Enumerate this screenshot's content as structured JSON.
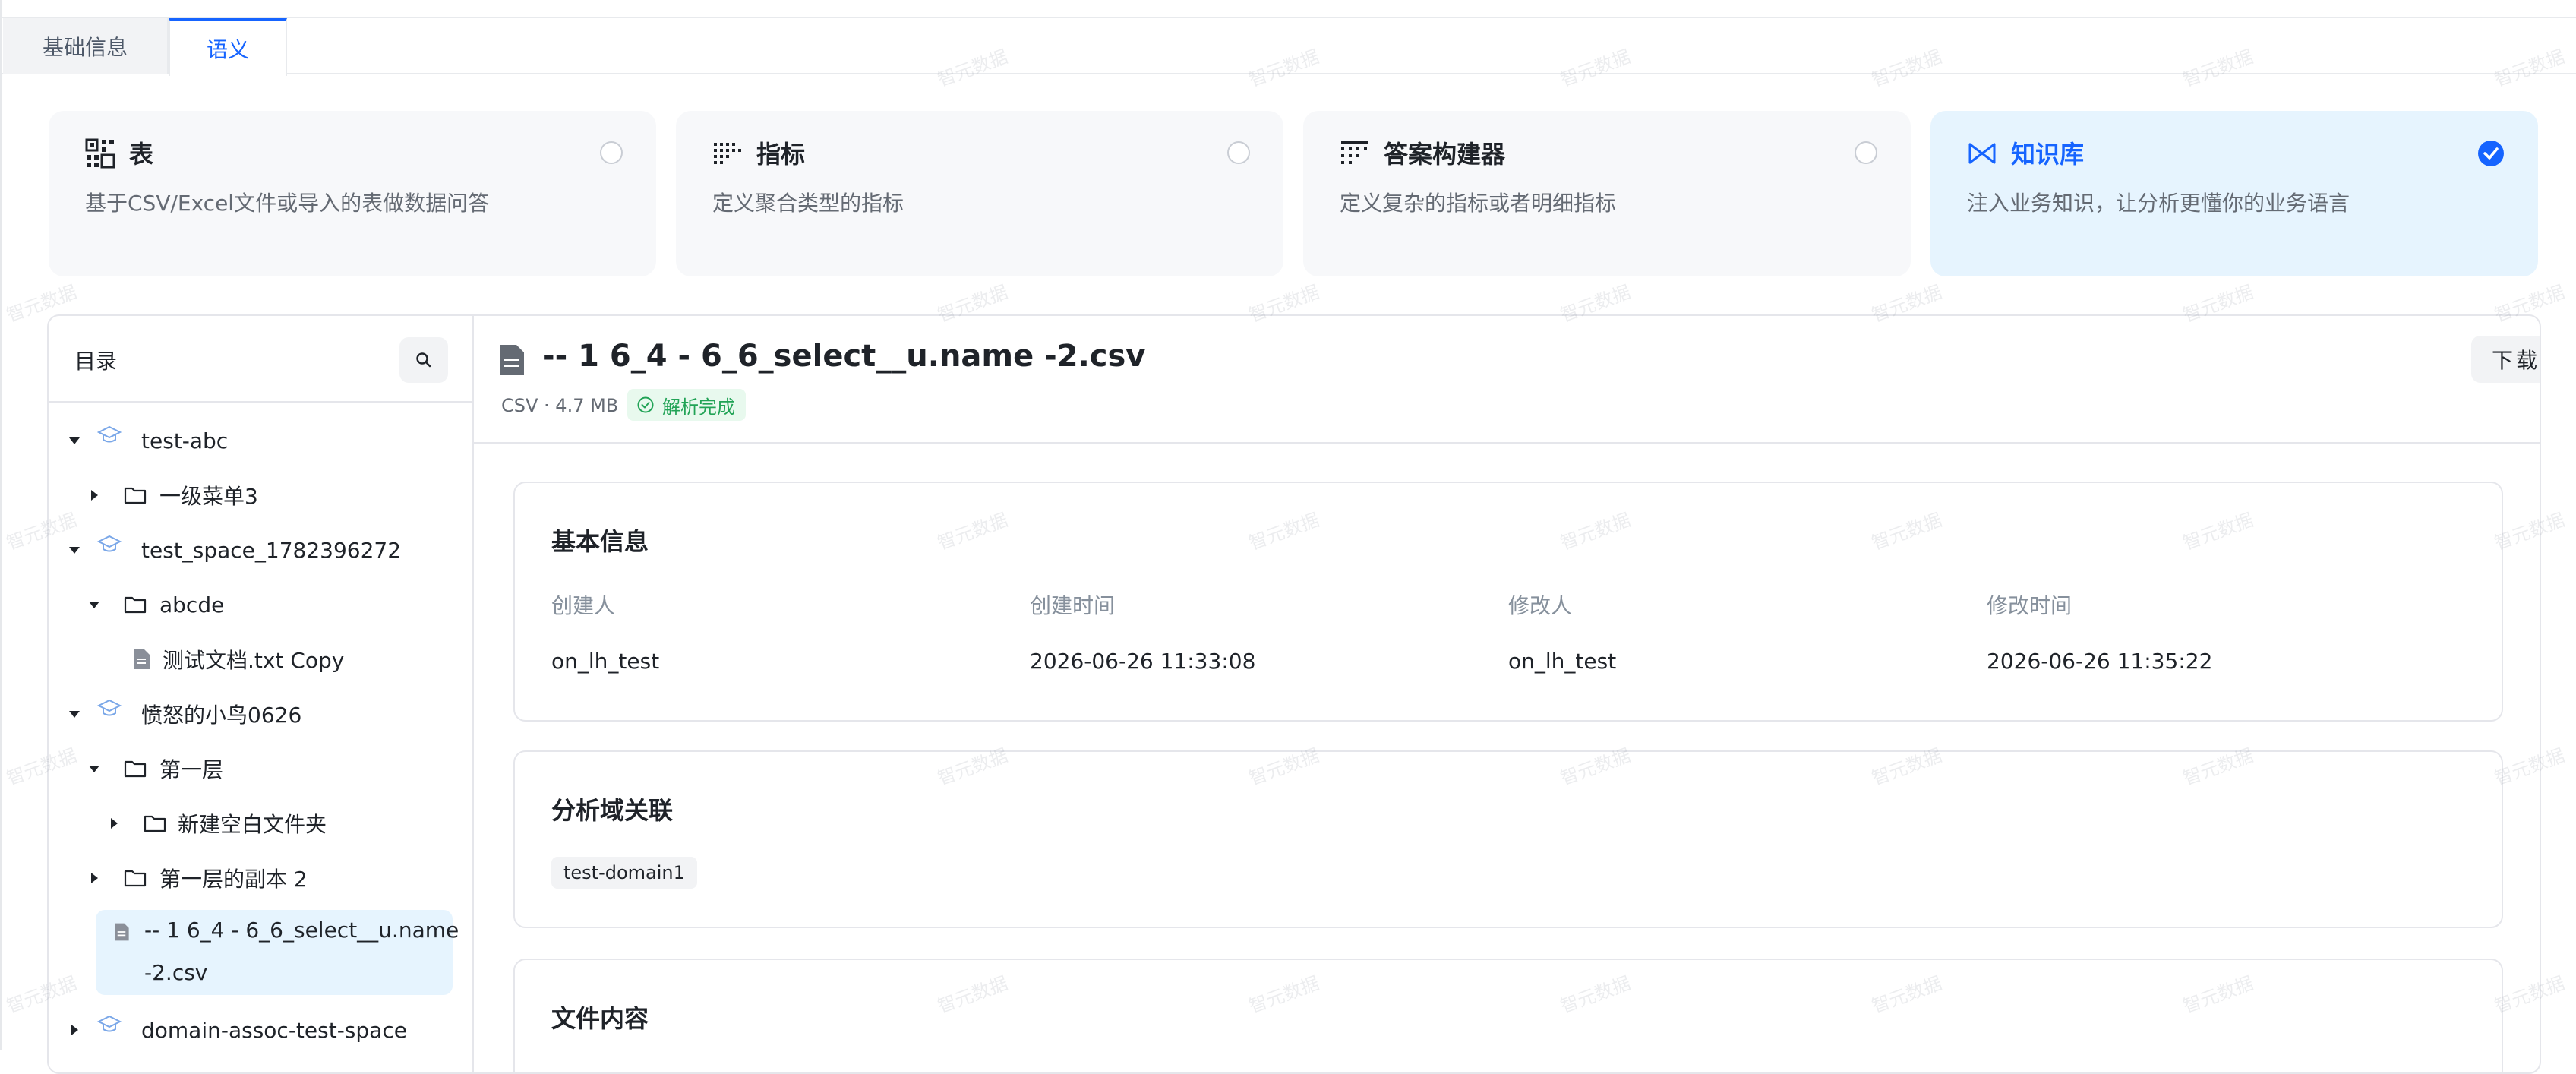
{
  "tabs": {
    "basic": "基础信息",
    "semantic": "语义"
  },
  "cards": [
    {
      "title": "表",
      "desc": "基于CSV/Excel文件或导入的表做数据问答",
      "icon": "table-grid-icon",
      "selected": false
    },
    {
      "title": "指标",
      "desc": "定义聚合类型的指标",
      "icon": "metric-dots-icon",
      "selected": false
    },
    {
      "title": "答案构建器",
      "desc": "定义复杂的指标或者明细指标",
      "icon": "answer-builder-icon",
      "selected": false
    },
    {
      "title": "知识库",
      "desc": "注入业务知识，让分析更懂你的业务语言",
      "icon": "knowledge-icon",
      "selected": true
    }
  ],
  "sidebar": {
    "title": "目录",
    "search_icon": "search-icon",
    "tree": [
      {
        "label": "test-abc",
        "type": "space",
        "level": 0,
        "expanded": true
      },
      {
        "label": "一级菜单3",
        "type": "folder",
        "level": 1,
        "expanded": false
      },
      {
        "label": "test_space_1782396272",
        "type": "space",
        "level": 0,
        "expanded": true
      },
      {
        "label": "abcde",
        "type": "folder",
        "level": 1,
        "expanded": true
      },
      {
        "label": "测试文档.txt Copy",
        "type": "file",
        "level": 2
      },
      {
        "label": "愤怒的小鸟0626",
        "type": "space",
        "level": 0,
        "expanded": true
      },
      {
        "label": "第一层",
        "type": "folder",
        "level": 1,
        "expanded": true
      },
      {
        "label": "新建空白文件夹",
        "type": "folder",
        "level": 2,
        "expanded": false
      },
      {
        "label": "第一层的副本 2",
        "type": "folder",
        "level": 1,
        "expanded": false
      },
      {
        "label_line1": "-- 1 6_4 - 6_6_select__u.name",
        "label_line2": "-2.csv",
        "type": "file",
        "level": 1,
        "selected": true
      },
      {
        "label": "domain-assoc-test-space",
        "type": "space",
        "level": 0,
        "expanded": false
      }
    ]
  },
  "file": {
    "title": "-- 1 6_4 - 6_6_select__u.name -2.csv",
    "meta": "CSV · 4.7 MB",
    "status": "解析完成",
    "download": "下载"
  },
  "basic_info": {
    "title": "基本信息",
    "labels": [
      "创建人",
      "创建时间",
      "修改人",
      "修改时间"
    ],
    "values": [
      "on_lh_test",
      "2026-06-26 11:33:08",
      "on_lh_test",
      "2026-06-26 11:35:22"
    ]
  },
  "domain_section": {
    "title": "分析域关联",
    "tag": "test-domain1"
  },
  "content_section": {
    "title": "文件内容"
  },
  "watermark_text": "智元数据"
}
